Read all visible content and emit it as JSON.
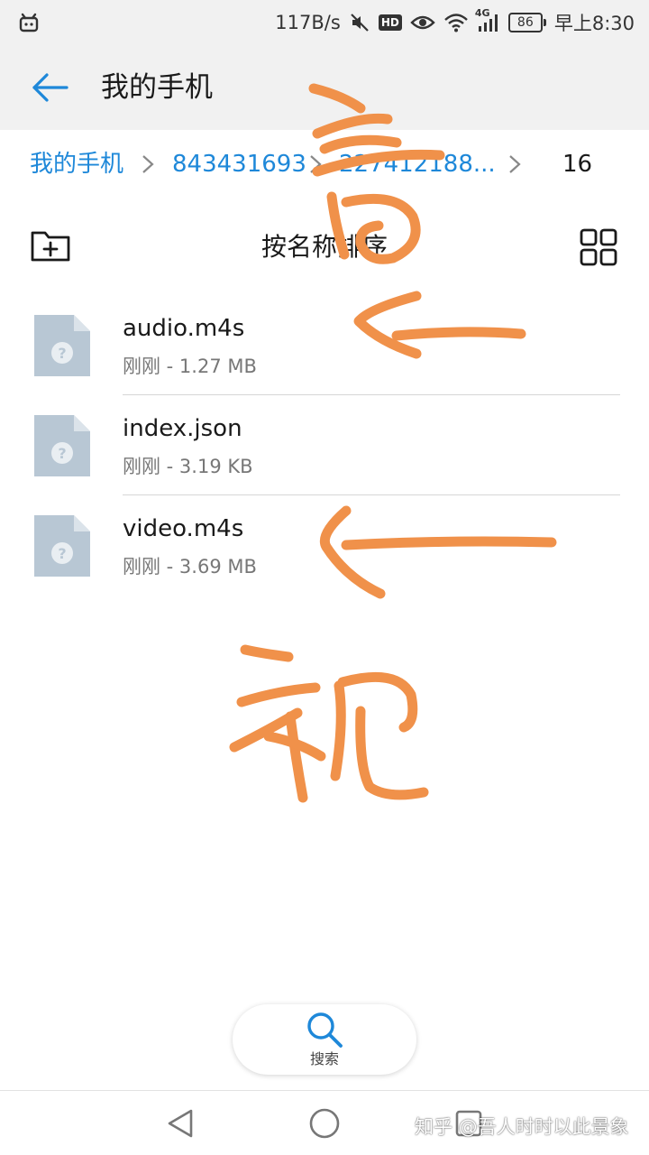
{
  "status_bar": {
    "net_speed": "117B/s",
    "hd_badge": "HD",
    "network_type": "4G",
    "battery_level": "86",
    "time": "早上8:30",
    "icons": [
      "bilibili-icon",
      "mute-icon",
      "eye-icon",
      "wifi-icon",
      "signal-icon",
      "battery-icon"
    ]
  },
  "app_bar": {
    "title": "我的手机"
  },
  "breadcrumb": {
    "items": [
      {
        "label": "我的手机"
      },
      {
        "label": "843431693"
      },
      {
        "label": "227412188..."
      },
      {
        "label": "16"
      }
    ]
  },
  "toolbar": {
    "sort_label": "按名称排序"
  },
  "files": [
    {
      "name": "audio.m4s",
      "meta": "刚刚 - 1.27 MB"
    },
    {
      "name": "index.json",
      "meta": "刚刚 - 3.19 KB"
    },
    {
      "name": "video.m4s",
      "meta": "刚刚 - 3.69 MB"
    }
  ],
  "search": {
    "label": "搜索"
  },
  "watermark": "知乎 @吾人时时以此景象",
  "colors": {
    "accent": "#1e88d9",
    "annotation": "#f0914a",
    "file_icon": "#b8c7d4"
  }
}
